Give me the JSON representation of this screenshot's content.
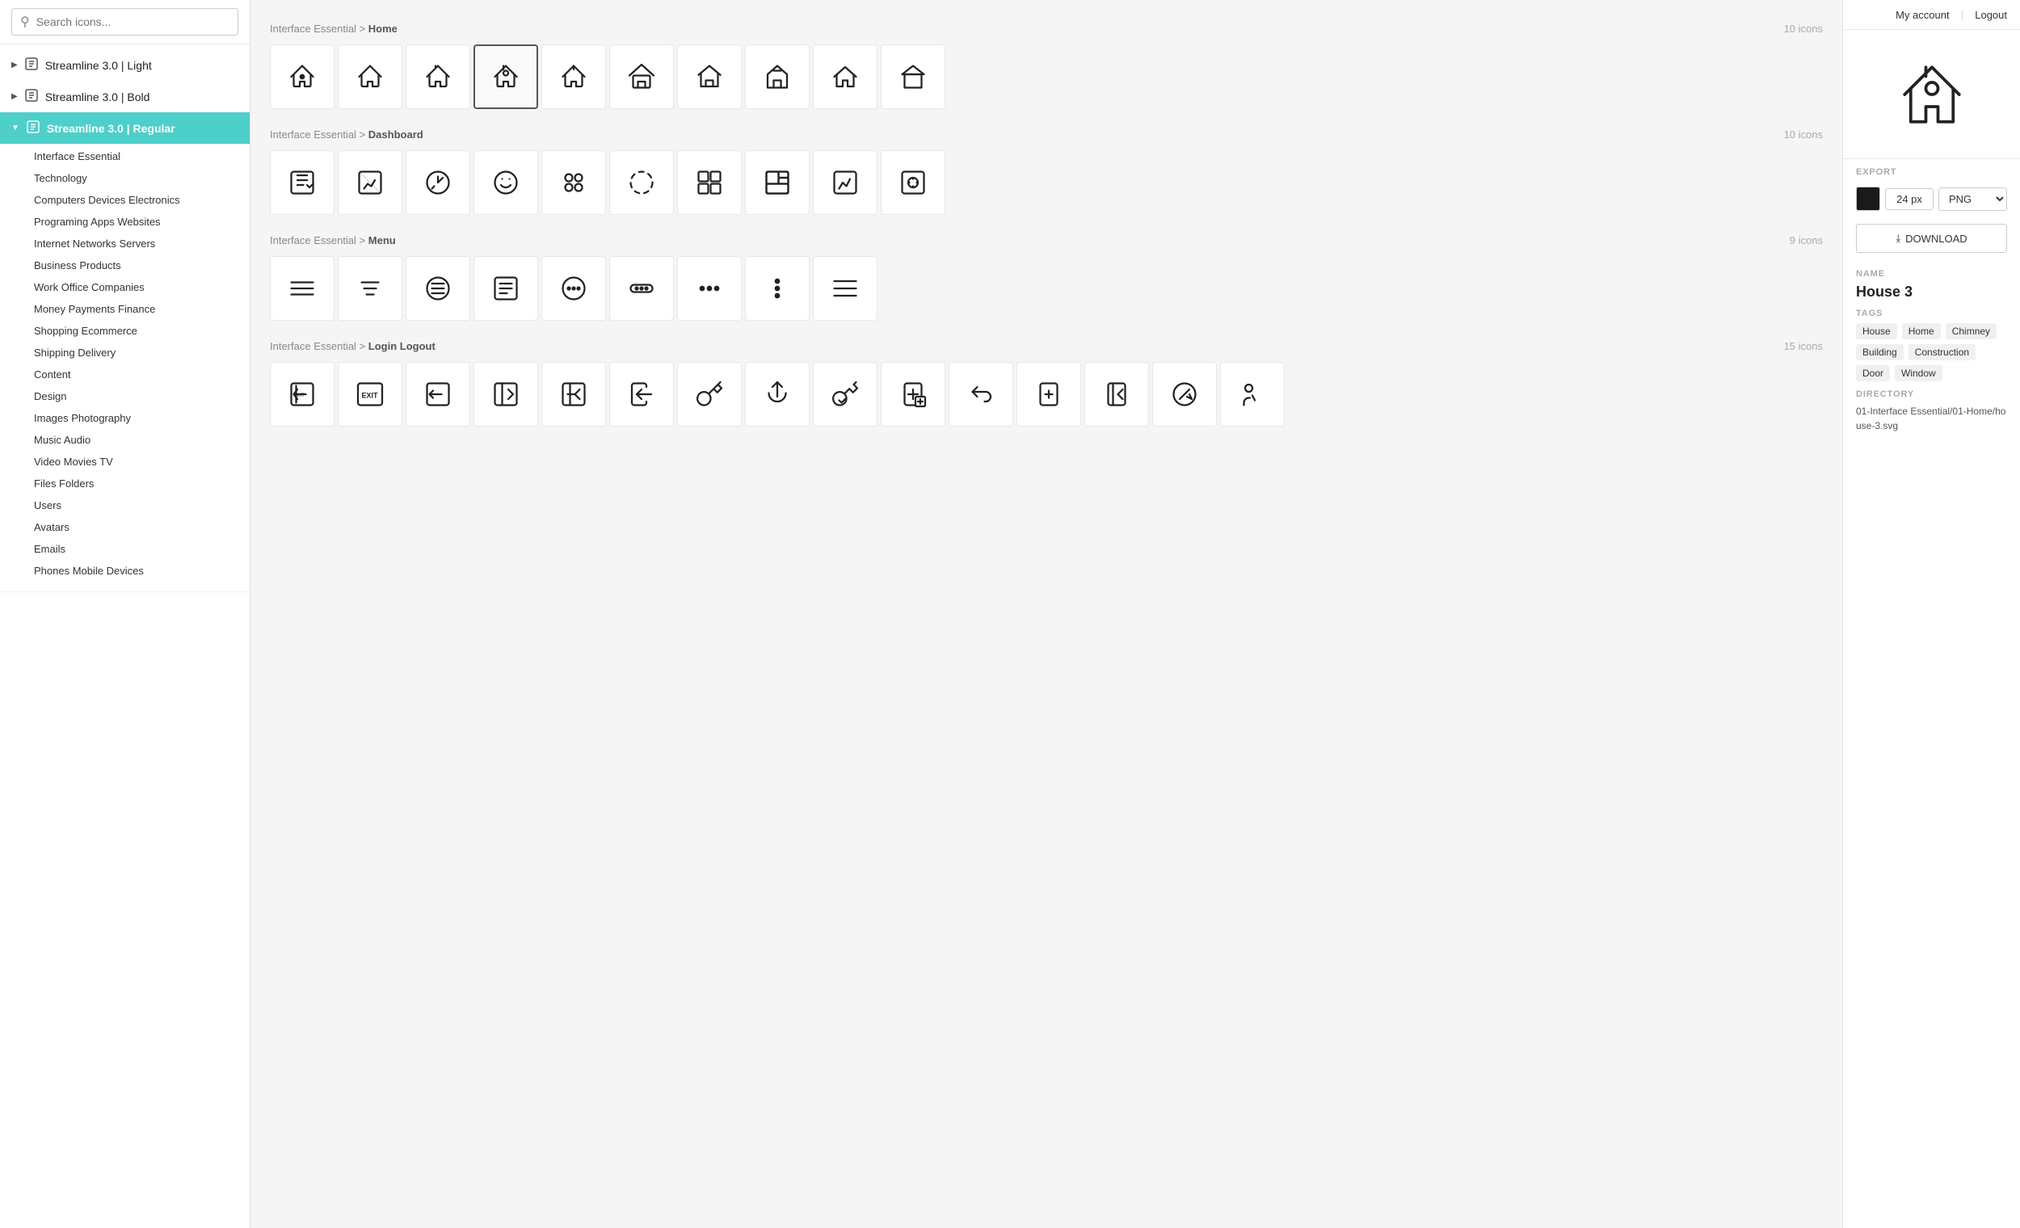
{
  "search": {
    "placeholder": "Search icons..."
  },
  "collections": [
    {
      "id": "light",
      "label": "Streamline 3.0 | Light",
      "expanded": false,
      "active": false
    },
    {
      "id": "bold",
      "label": "Streamline 3.0 | Bold",
      "expanded": false,
      "active": false
    },
    {
      "id": "regular",
      "label": "Streamline 3.0 | Regular",
      "expanded": true,
      "active": true
    }
  ],
  "subitems": [
    "Interface Essential",
    "Technology",
    "Computers Devices Electronics",
    "Programing Apps Websites",
    "Internet Networks Servers",
    "Business Products",
    "Work Office Companies",
    "Money Payments Finance",
    "Shopping Ecommerce",
    "Shipping Delivery",
    "Content",
    "Design",
    "Images Photography",
    "Music Audio",
    "Video Movies TV",
    "Files Folders",
    "Users",
    "Avatars",
    "Emails",
    "Phones Mobile Devices"
  ],
  "sections": [
    {
      "breadcrumb_prefix": "Interface Essential",
      "breadcrumb_sep": " > ",
      "breadcrumb_name": "Home",
      "icon_count": "10 icons"
    },
    {
      "breadcrumb_prefix": "Interface Essential",
      "breadcrumb_sep": " > ",
      "breadcrumb_name": "Dashboard",
      "icon_count": "10 icons"
    },
    {
      "breadcrumb_prefix": "Interface Essential",
      "breadcrumb_sep": " > ",
      "breadcrumb_name": "Menu",
      "icon_count": "9 icons"
    },
    {
      "breadcrumb_prefix": "Interface Essential",
      "breadcrumb_sep": " > ",
      "breadcrumb_name": "Login Logout",
      "icon_count": "15 icons"
    }
  ],
  "right_panel": {
    "my_account": "My account",
    "logout": "Logout",
    "export_label": "EXPORT",
    "size_value": "24 px",
    "format_value": "PNG",
    "download_label": "DOWNLOAD",
    "name_label": "NAME",
    "icon_name": "House 3",
    "tags_label": "TAGS",
    "tags": [
      "House",
      "Home",
      "Chimney",
      "Building",
      "Construction",
      "Door",
      "Window"
    ],
    "directory_label": "DIRECTORY",
    "directory_value": "01-Interface Essential/01-Home/house-3.svg"
  }
}
